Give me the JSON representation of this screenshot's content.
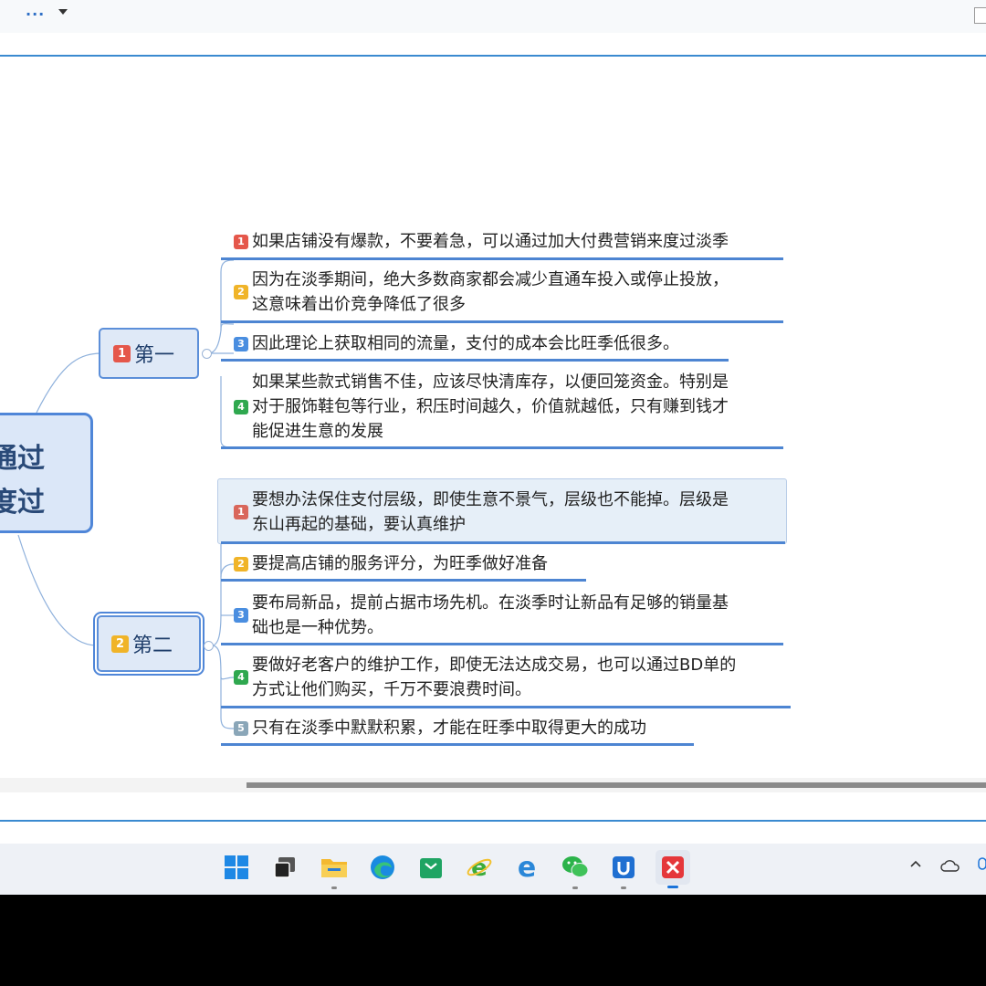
{
  "toolbar": {
    "more_icon": "more-dots-icon",
    "dropdown_icon": "caret-down-icon"
  },
  "root": {
    "line1": "通过",
    "line2": "度过"
  },
  "branches": [
    {
      "badge": "1",
      "badge_color": "#e5574b",
      "label": "第一",
      "items": [
        {
          "badge": "1",
          "color": "#e5574b",
          "lines": [
            "如果店铺没有爆款，不要着急，可以通过加大付费营销来度过淡季"
          ]
        },
        {
          "badge": "2",
          "color": "#f0b429",
          "lines": [
            "因为在淡季期间，绝大多数商家都会减少直通车投入或停止投放，",
            "这意味着出价竞争降低了很多"
          ]
        },
        {
          "badge": "3",
          "color": "#4a8ee0",
          "lines": [
            "因此理论上获取相同的流量，支付的成本会比旺季低很多。"
          ]
        },
        {
          "badge": "4",
          "color": "#2fa84f",
          "lines": [
            "如果某些款式销售不佳，应该尽快清库存，以便回笼资金。特别是",
            "对于服饰鞋包等行业，积压时间越久，价值就越低，只有赚到钱才",
            "能促进生意的发展"
          ]
        }
      ]
    },
    {
      "badge": "2",
      "badge_color": "#f0b429",
      "label": "第二",
      "items": [
        {
          "badge": "1",
          "color": "#d9675c",
          "lines": [
            "要想办法保住支付层级，即使生意不景气，层级也不能掉。层级是",
            "东山再起的基础，要认真维护"
          ]
        },
        {
          "badge": "2",
          "color": "#f0b429",
          "lines": [
            "要提高店铺的服务评分，为旺季做好准备"
          ]
        },
        {
          "badge": "3",
          "color": "#4a8ee0",
          "lines": [
            "要布局新品，提前占据市场先机。在淡季时让新品有足够的销量基",
            "础也是一种优势。"
          ]
        },
        {
          "badge": "4",
          "color": "#2fa84f",
          "lines": [
            "要做好老客户的维护工作，即使无法达成交易，也可以通过BD单的",
            "方式让他们购买，千万不要浪费时间。"
          ]
        },
        {
          "badge": "5",
          "color": "#8aa6b8",
          "lines": [
            "只有在淡季中默默积累，才能在旺季中取得更大的成功"
          ]
        }
      ]
    }
  ],
  "taskbar": {
    "apps": [
      "windows-start-icon",
      "task-view-icon",
      "file-explorer-icon",
      "edge-icon",
      "store-icon",
      "ie-icon",
      "edge-legacy-icon",
      "wechat-icon",
      "app-icon",
      "xmind-icon"
    ],
    "tray": [
      "chevron-up-icon",
      "cloud-icon"
    ]
  }
}
